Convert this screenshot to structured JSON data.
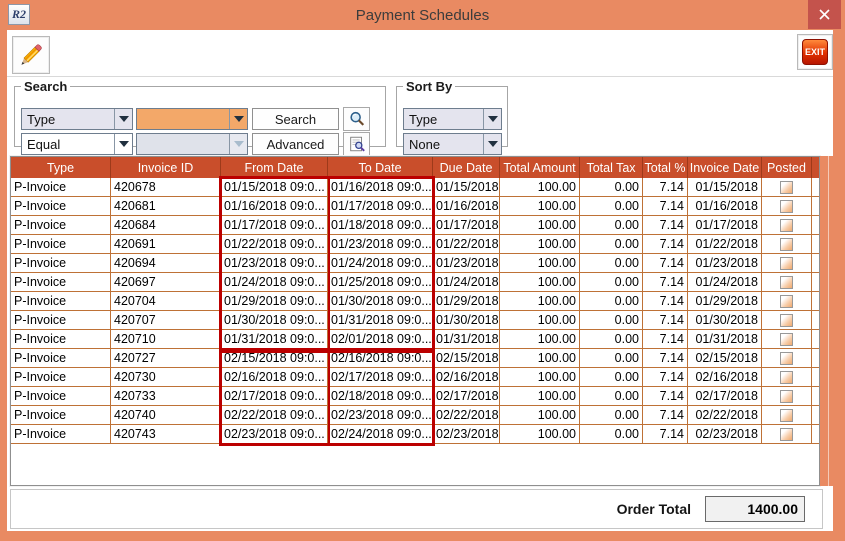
{
  "window": {
    "title": "Payment Schedules",
    "app_badge": "R2"
  },
  "toolbar": {
    "exit_label": "EXIT"
  },
  "search": {
    "legend": "Search",
    "field_dropdown": "Type",
    "operator_dropdown": "Equal",
    "value_input": "",
    "value2_input": "",
    "search_button": "Search",
    "advanced_button": "Advanced"
  },
  "sort_by": {
    "legend": "Sort By",
    "primary_dropdown": "Type",
    "secondary_dropdown": "None"
  },
  "table": {
    "columns": [
      "Type",
      "Invoice ID",
      "From Date",
      "To Date",
      "Due Date",
      "Total Amount",
      "Total Tax",
      "Total %",
      "Invoice Date",
      "Posted"
    ],
    "rows": [
      {
        "type": "P-Invoice",
        "invoice_id": "420678",
        "from_date": "01/15/2018 09:0...",
        "to_date": "01/16/2018 09:0...",
        "due_date": "01/15/2018",
        "total_amount": "100.00",
        "total_tax": "0.00",
        "total_pct": "7.14",
        "invoice_date": "01/15/2018",
        "posted": false
      },
      {
        "type": "P-Invoice",
        "invoice_id": "420681",
        "from_date": "01/16/2018 09:0...",
        "to_date": "01/17/2018 09:0...",
        "due_date": "01/16/2018",
        "total_amount": "100.00",
        "total_tax": "0.00",
        "total_pct": "7.14",
        "invoice_date": "01/16/2018",
        "posted": false
      },
      {
        "type": "P-Invoice",
        "invoice_id": "420684",
        "from_date": "01/17/2018 09:0...",
        "to_date": "01/18/2018 09:0...",
        "due_date": "01/17/2018",
        "total_amount": "100.00",
        "total_tax": "0.00",
        "total_pct": "7.14",
        "invoice_date": "01/17/2018",
        "posted": false
      },
      {
        "type": "P-Invoice",
        "invoice_id": "420691",
        "from_date": "01/22/2018 09:0...",
        "to_date": "01/23/2018 09:0...",
        "due_date": "01/22/2018",
        "total_amount": "100.00",
        "total_tax": "0.00",
        "total_pct": "7.14",
        "invoice_date": "01/22/2018",
        "posted": false
      },
      {
        "type": "P-Invoice",
        "invoice_id": "420694",
        "from_date": "01/23/2018 09:0...",
        "to_date": "01/24/2018 09:0...",
        "due_date": "01/23/2018",
        "total_amount": "100.00",
        "total_tax": "0.00",
        "total_pct": "7.14",
        "invoice_date": "01/23/2018",
        "posted": false
      },
      {
        "type": "P-Invoice",
        "invoice_id": "420697",
        "from_date": "01/24/2018 09:0...",
        "to_date": "01/25/2018 09:0...",
        "due_date": "01/24/2018",
        "total_amount": "100.00",
        "total_tax": "0.00",
        "total_pct": "7.14",
        "invoice_date": "01/24/2018",
        "posted": false
      },
      {
        "type": "P-Invoice",
        "invoice_id": "420704",
        "from_date": "01/29/2018 09:0...",
        "to_date": "01/30/2018 09:0...",
        "due_date": "01/29/2018",
        "total_amount": "100.00",
        "total_tax": "0.00",
        "total_pct": "7.14",
        "invoice_date": "01/29/2018",
        "posted": false
      },
      {
        "type": "P-Invoice",
        "invoice_id": "420707",
        "from_date": "01/30/2018 09:0...",
        "to_date": "01/31/2018 09:0...",
        "due_date": "01/30/2018",
        "total_amount": "100.00",
        "total_tax": "0.00",
        "total_pct": "7.14",
        "invoice_date": "01/30/2018",
        "posted": false
      },
      {
        "type": "P-Invoice",
        "invoice_id": "420710",
        "from_date": "01/31/2018 09:0...",
        "to_date": "02/01/2018 09:0...",
        "due_date": "01/31/2018",
        "total_amount": "100.00",
        "total_tax": "0.00",
        "total_pct": "7.14",
        "invoice_date": "01/31/2018",
        "posted": false
      },
      {
        "type": "P-Invoice",
        "invoice_id": "420727",
        "from_date": "02/15/2018 09:0...",
        "to_date": "02/16/2018 09:0...",
        "due_date": "02/15/2018",
        "total_amount": "100.00",
        "total_tax": "0.00",
        "total_pct": "7.14",
        "invoice_date": "02/15/2018",
        "posted": false
      },
      {
        "type": "P-Invoice",
        "invoice_id": "420730",
        "from_date": "02/16/2018 09:0...",
        "to_date": "02/17/2018 09:0...",
        "due_date": "02/16/2018",
        "total_amount": "100.00",
        "total_tax": "0.00",
        "total_pct": "7.14",
        "invoice_date": "02/16/2018",
        "posted": false
      },
      {
        "type": "P-Invoice",
        "invoice_id": "420733",
        "from_date": "02/17/2018 09:0...",
        "to_date": "02/18/2018 09:0...",
        "due_date": "02/17/2018",
        "total_amount": "100.00",
        "total_tax": "0.00",
        "total_pct": "7.14",
        "invoice_date": "02/17/2018",
        "posted": false
      },
      {
        "type": "P-Invoice",
        "invoice_id": "420740",
        "from_date": "02/22/2018 09:0...",
        "to_date": "02/23/2018 09:0...",
        "due_date": "02/22/2018",
        "total_amount": "100.00",
        "total_tax": "0.00",
        "total_pct": "7.14",
        "invoice_date": "02/22/2018",
        "posted": false
      },
      {
        "type": "P-Invoice",
        "invoice_id": "420743",
        "from_date": "02/23/2018 09:0...",
        "to_date": "02/24/2018 09:0...",
        "due_date": "02/23/2018",
        "total_amount": "100.00",
        "total_tax": "0.00",
        "total_pct": "7.14",
        "invoice_date": "02/23/2018",
        "posted": false
      }
    ],
    "highlight_groups": [
      {
        "rows": "1-9"
      },
      {
        "rows": "10-14"
      }
    ]
  },
  "footer": {
    "order_total_label": "Order Total",
    "order_total_value": "1400.00"
  },
  "colors": {
    "titlebar": "#E98A62",
    "close_button": "#C4534C",
    "table_header": "#C94E2B",
    "grid_line": "#BE7136",
    "group_outline": "#BB0000",
    "highlight_combo": "#F3A869"
  }
}
